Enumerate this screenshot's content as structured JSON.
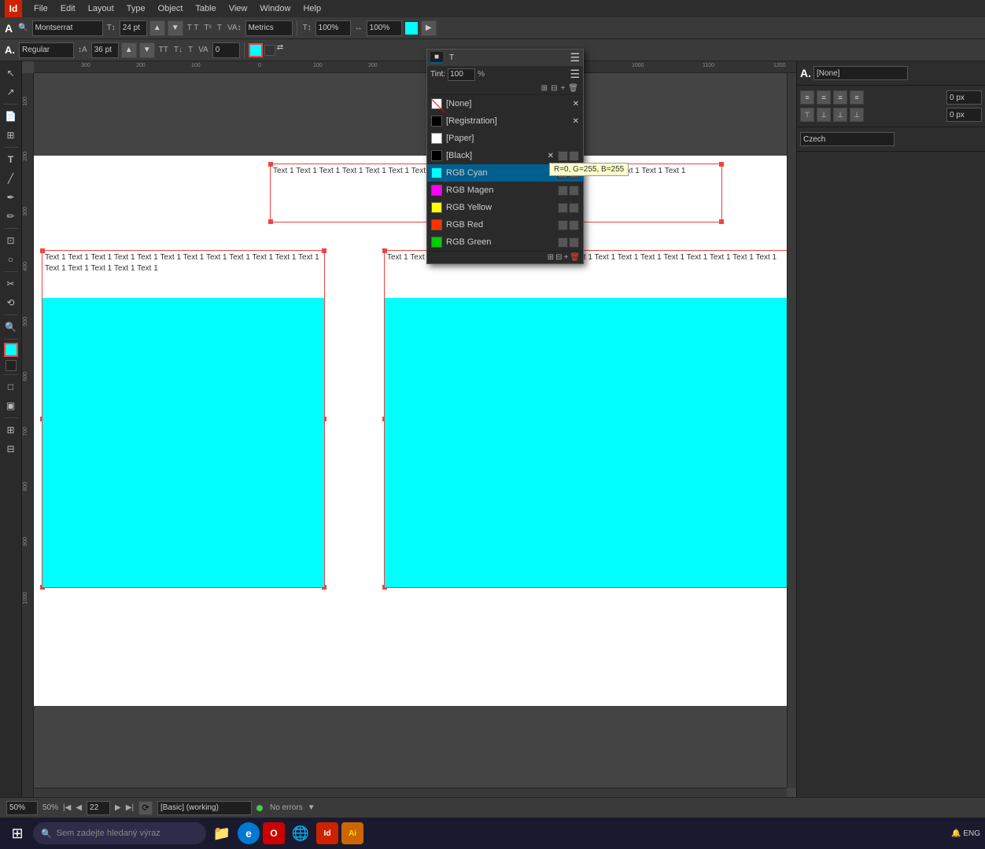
{
  "app": {
    "logo": "Id",
    "title": "InDesign"
  },
  "menu": {
    "items": [
      "File",
      "Edit",
      "Layout",
      "Type",
      "Object",
      "Table",
      "View",
      "Window",
      "Help"
    ]
  },
  "toolbar1": {
    "font_label": "A",
    "font_name": "Montserrat",
    "font_size": "24 pt",
    "tracking": "Metrics",
    "scale": "100%",
    "horiz_scale": "100%",
    "style": "Regular",
    "leading": "36 pt",
    "baseline": "0"
  },
  "color_panel": {
    "title_tab1": "■",
    "title_tab2": "T",
    "tint_label": "Tint:",
    "tint_value": "100",
    "percent": "%",
    "items": [
      {
        "name": "[None]",
        "swatch": "none",
        "has_x": true
      },
      {
        "name": "[Registration]",
        "swatch": "#000",
        "has_x": true
      },
      {
        "name": "[Paper]",
        "swatch": "#fff",
        "has_x": false
      },
      {
        "name": "[Black]",
        "swatch": "#000",
        "has_x": true
      },
      {
        "name": "RGB Cyan",
        "swatch": "#00ffff",
        "has_x": false,
        "selected": true
      },
      {
        "name": "RGB Magen",
        "swatch": "#ff00ff",
        "has_x": false
      },
      {
        "name": "RGB Yellow",
        "swatch": "#ffff00",
        "has_x": false
      },
      {
        "name": "RGB Red",
        "swatch": "#ff3300",
        "has_x": false
      },
      {
        "name": "RGB Green",
        "swatch": "#00cc00",
        "has_x": false
      }
    ],
    "tooltip": "R=0, G=255, B=255"
  },
  "canvas": {
    "zoom": "50%",
    "page": "22",
    "style": "[Basic] (working)",
    "errors": "No errors"
  },
  "right_panel": {
    "style_label": "A",
    "style_value": "[None]",
    "lang_value": "Czech",
    "px_value1": "0 px",
    "px_value2": "0 px"
  },
  "frames": {
    "top_text": "Text 1 Text 1 Text 1 Text 1 Text 1 Text 1 Text 1\nText 1 Text 1 Text 1 Text 1 Text 1 Text 1 Text 1 Text 1\nText 1 Text 1 Text 1",
    "bl_text": "Text 1 Text 1 Text 1 Text 1 Text 1 Text 1 Text 1\nText 1 Text 1 Text 1 Text 1 Text 1 Text 1 Text 1\nText 1 Text 1 Text 1",
    "br_text": "Text 1 Text 1 Text 1 Text 1 Text 1 Text 1 Text 1\nText 1 Text 1 Text 1 Text 1 Text 1 Text 1 Text 1\nText 1 Text 1 Text 1"
  },
  "taskbar": {
    "search_placeholder": "Sem zadejte hledaný výraz",
    "ai_label": "Ai"
  }
}
